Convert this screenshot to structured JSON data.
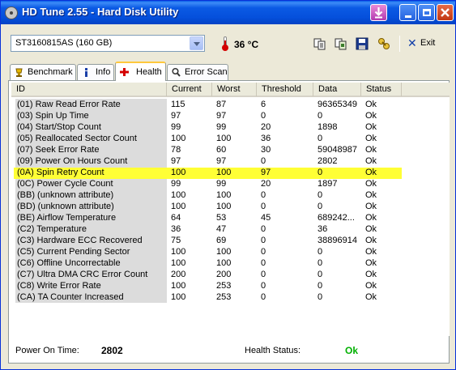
{
  "window": {
    "title": "HD Tune 2.55 - Hard Disk Utility"
  },
  "toolbar": {
    "drive": "ST3160815AS (160 GB)",
    "temperature": "36 °C",
    "exit_label": "Exit"
  },
  "icons": {
    "app": "hdd-icon",
    "copy_text": "copy-text-icon",
    "copy_screenshot": "copy-screenshot-icon",
    "save": "floppy-save-icon",
    "options": "options-icon",
    "exit": "close-x-icon"
  },
  "tabs": [
    {
      "label": "Benchmark",
      "icon": "benchmark-icon"
    },
    {
      "label": "Info",
      "icon": "info-icon"
    },
    {
      "label": "Health",
      "icon": "health-cross-icon"
    },
    {
      "label": "Error Scan",
      "icon": "error-scan-icon"
    }
  ],
  "table": {
    "headers": [
      "ID",
      "Current",
      "Worst",
      "Threshold",
      "Data",
      "Status"
    ],
    "rows": [
      {
        "id": "(01) Raw Read Error Rate",
        "current": "115",
        "worst": "87",
        "threshold": "6",
        "data": "96365349",
        "status": "Ok"
      },
      {
        "id": "(03) Spin Up Time",
        "current": "97",
        "worst": "97",
        "threshold": "0",
        "data": "0",
        "status": "Ok"
      },
      {
        "id": "(04) Start/Stop Count",
        "current": "99",
        "worst": "99",
        "threshold": "20",
        "data": "1898",
        "status": "Ok"
      },
      {
        "id": "(05) Reallocated Sector Count",
        "current": "100",
        "worst": "100",
        "threshold": "36",
        "data": "0",
        "status": "Ok"
      },
      {
        "id": "(07) Seek Error Rate",
        "current": "78",
        "worst": "60",
        "threshold": "30",
        "data": "59048987",
        "status": "Ok"
      },
      {
        "id": "(09) Power On Hours Count",
        "current": "97",
        "worst": "97",
        "threshold": "0",
        "data": "2802",
        "status": "Ok"
      },
      {
        "id": "(0A) Spin Retry Count",
        "current": "100",
        "worst": "100",
        "threshold": "97",
        "data": "0",
        "status": "Ok"
      },
      {
        "id": "(0C) Power Cycle Count",
        "current": "99",
        "worst": "99",
        "threshold": "20",
        "data": "1897",
        "status": "Ok"
      },
      {
        "id": "(BB) (unknown attribute)",
        "current": "100",
        "worst": "100",
        "threshold": "0",
        "data": "0",
        "status": "Ok"
      },
      {
        "id": "(BD) (unknown attribute)",
        "current": "100",
        "worst": "100",
        "threshold": "0",
        "data": "0",
        "status": "Ok"
      },
      {
        "id": "(BE) Airflow Temperature",
        "current": "64",
        "worst": "53",
        "threshold": "45",
        "data": "689242...",
        "status": "Ok"
      },
      {
        "id": "(C2) Temperature",
        "current": "36",
        "worst": "47",
        "threshold": "0",
        "data": "36",
        "status": "Ok"
      },
      {
        "id": "(C3) Hardware ECC Recovered",
        "current": "75",
        "worst": "69",
        "threshold": "0",
        "data": "38896914",
        "status": "Ok"
      },
      {
        "id": "(C5) Current Pending Sector",
        "current": "100",
        "worst": "100",
        "threshold": "0",
        "data": "0",
        "status": "Ok"
      },
      {
        "id": "(C6) Offline Uncorrectable",
        "current": "100",
        "worst": "100",
        "threshold": "0",
        "data": "0",
        "status": "Ok"
      },
      {
        "id": "(C7) Ultra DMA CRC Error Count",
        "current": "200",
        "worst": "200",
        "threshold": "0",
        "data": "0",
        "status": "Ok"
      },
      {
        "id": "(C8) Write Error Rate",
        "current": "100",
        "worst": "253",
        "threshold": "0",
        "data": "0",
        "status": "Ok"
      },
      {
        "id": "(CA) TA Counter Increased",
        "current": "100",
        "worst": "253",
        "threshold": "0",
        "data": "0",
        "status": "Ok"
      }
    ],
    "highlighted_row": "(0A) Spin Retry Count",
    "highlight_color": "#ffff35"
  },
  "footer": {
    "power_on_time_label": "Power On Time:",
    "power_on_time_value": "2802",
    "health_status_label": "Health Status:",
    "health_status_value": "Ok",
    "health_status_color": "#00b000"
  }
}
